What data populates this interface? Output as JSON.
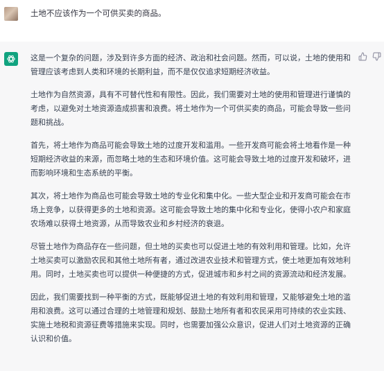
{
  "user_message": {
    "text": "土地不应该作为一个可供买卖的商品。"
  },
  "assistant_message": {
    "paragraphs": [
      "这是一个复杂的问题，涉及到许多方面的经济、政治和社会问题。然而，可以说，土地的使用和管理应该考虑到人类和环境的长期利益，而不是仅仅追求短期经济收益。",
      "土地作为自然资源，具有不可替代性和有限性。因此，我们需要对土地的使用和管理进行谨慎的考虑，以避免对土地资源造成损害和浪费。将土地作为一个可供买卖的商品，可能会导致一些问题和挑战。",
      "首先，将土地作为商品可能会导致土地的过度开发和滥用。一些开发商可能会将土地看作是一种短期经济收益的来源，而忽略土地的生态和环境价值。这可能会导致土地的过度开发和破坏，进而影响环境和生态系统的平衡。",
      "其次，将土地作为商品也可能会导致土地的专业化和集中化。一些大型企业和开发商可能会在市场上竞争，以获得更多的土地和资源。这可能会导致土地的集中化和专业化，使得小农户和家庭农场难以获得土地资源，从而导致农业和乡村经济的衰退。",
      "尽管土地作为商品存在一些问题，但土地的买卖也可以促进土地的有效利用和管理。比如，允许土地买卖可以激励农民和其他土地所有者，通过改进农业技术和管理方式，使土地更加有效地利用。同时，土地买卖也可以提供一种便捷的方式，促进城市和乡村之间的资源流动和经济发展。",
      "因此，我们需要找到一种平衡的方式，既能够促进土地的有效利用和管理，又能够避免土地的滥用和浪费。这可以通过合理的土地管理和规划、鼓励土地所有者和农民采用可持续的农业实践、实施土地税和资源征费等措施来实现。同时，也需要加强公众意识，促进人们对土地资源的正确认识和价值。"
    ]
  },
  "icons": {
    "user_avatar": "user-avatar",
    "assistant_avatar": "openai-logo-icon",
    "like": "thumbs-up-icon",
    "dislike": "thumbs-down-icon"
  },
  "colors": {
    "assistant_background": "#f7f7f8",
    "assistant_avatar_background": "#10a37f",
    "text": "#374151"
  }
}
